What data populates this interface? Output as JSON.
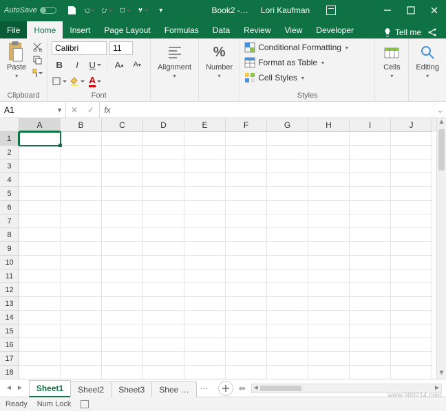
{
  "titlebar": {
    "autosave_label": "AutoSave",
    "doc_title": "Book2 -…",
    "user_name": "Lori Kaufman"
  },
  "tabs": {
    "file": "File",
    "list": [
      "Home",
      "Insert",
      "Page Layout",
      "Formulas",
      "Data",
      "Review",
      "View",
      "Developer"
    ],
    "active_index": 0,
    "tell_me": "Tell me"
  },
  "ribbon": {
    "clipboard": {
      "group_label": "Clipboard",
      "paste_label": "Paste"
    },
    "font": {
      "group_label": "Font",
      "font_name": "Calibri",
      "font_size": "11"
    },
    "alignment": {
      "label": "Alignment"
    },
    "number": {
      "label": "Number"
    },
    "styles": {
      "group_label": "Styles",
      "conditional": "Conditional Formatting",
      "table": "Format as Table",
      "cellstyles": "Cell Styles"
    },
    "cells": {
      "label": "Cells"
    },
    "editing": {
      "label": "Editing"
    }
  },
  "namebox": {
    "value": "A1"
  },
  "fxbar": {
    "fx_label": "fx",
    "formula_value": ""
  },
  "grid": {
    "columns": [
      "A",
      "B",
      "C",
      "D",
      "E",
      "F",
      "G",
      "H",
      "I",
      "J"
    ],
    "rows": [
      1,
      2,
      3,
      4,
      5,
      6,
      7,
      8,
      9,
      10,
      11,
      12,
      13,
      14,
      15,
      16,
      17,
      18
    ],
    "active_col": "A",
    "active_row": 1
  },
  "sheetbar": {
    "sheets": [
      "Sheet1",
      "Sheet2",
      "Sheet3",
      "Shee …"
    ],
    "active_index": 0,
    "ellipsis": "…",
    "dots": "⋯"
  },
  "status": {
    "ready": "Ready",
    "numlock": "Num Lock"
  },
  "watermark": "www.989214.com"
}
